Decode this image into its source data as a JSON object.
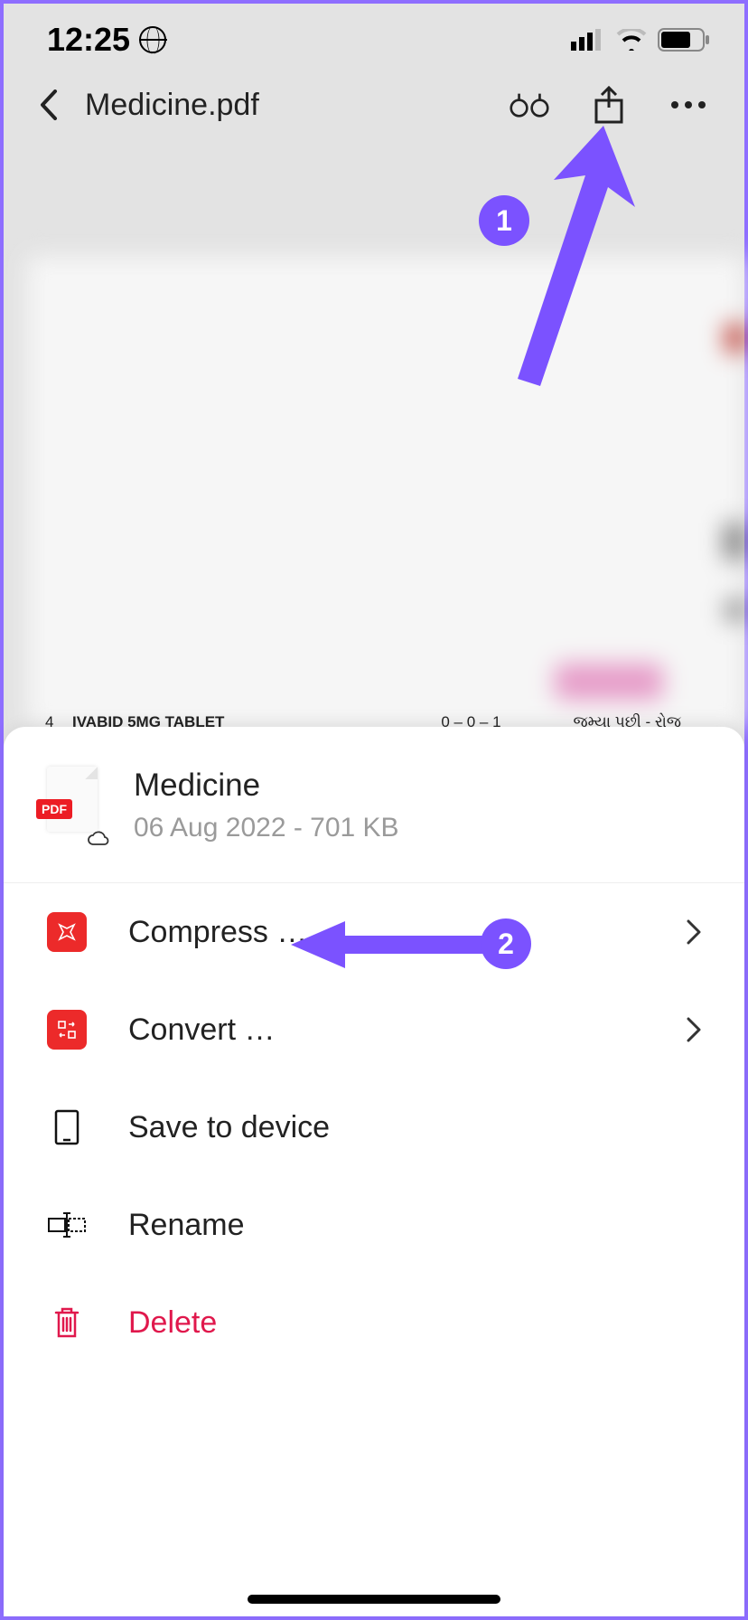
{
  "status": {
    "time": "12:25"
  },
  "topbar": {
    "title": "Medicine.pdf"
  },
  "doc_preview": {
    "row_num": "4",
    "row_text": "IVABID 5MG TABLET",
    "row_mid": "0 – 0 – 1",
    "row_right": "જમ્યા પછી - રોજ"
  },
  "sheet": {
    "file_name": "Medicine",
    "file_meta": "06 Aug 2022 - 701 KB",
    "pdf_badge": "PDF",
    "items": [
      {
        "label": "Compress …"
      },
      {
        "label": "Convert …"
      },
      {
        "label": "Save to device"
      },
      {
        "label": "Rename"
      },
      {
        "label": "Delete"
      }
    ]
  },
  "annotations": {
    "step1": "1",
    "step2": "2"
  }
}
